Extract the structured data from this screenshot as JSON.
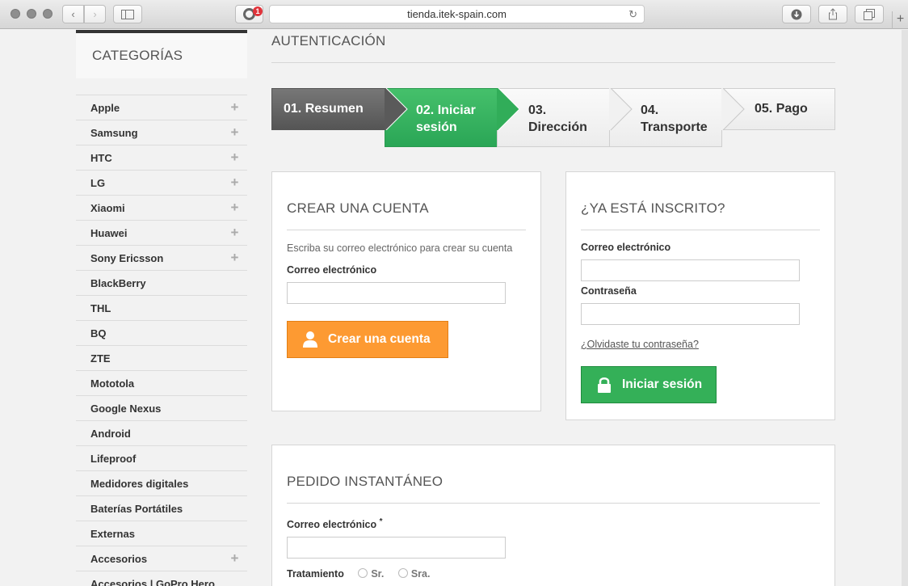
{
  "browser": {
    "url": "tienda.itek-spain.com",
    "extension_badge": "1"
  },
  "sidebar": {
    "title": "CATEGORÍAS",
    "items": [
      {
        "label": "Apple",
        "expandable": true
      },
      {
        "label": "Samsung",
        "expandable": true
      },
      {
        "label": "HTC",
        "expandable": true
      },
      {
        "label": "LG",
        "expandable": true
      },
      {
        "label": "Xiaomi",
        "expandable": true
      },
      {
        "label": "Huawei",
        "expandable": true
      },
      {
        "label": "Sony Ericsson",
        "expandable": true
      },
      {
        "label": "BlackBerry",
        "expandable": false
      },
      {
        "label": "THL",
        "expandable": false
      },
      {
        "label": "BQ",
        "expandable": false
      },
      {
        "label": "ZTE",
        "expandable": false
      },
      {
        "label": "Mototola",
        "expandable": false
      },
      {
        "label": "Google Nexus",
        "expandable": false
      },
      {
        "label": "Android",
        "expandable": false
      },
      {
        "label": "Lifeproof",
        "expandable": false
      },
      {
        "label": "Medidores digitales",
        "expandable": false
      },
      {
        "label": "Baterías Portátiles",
        "expandable": false
      },
      {
        "label": "Externas",
        "expandable": false
      },
      {
        "label": "Accesorios",
        "expandable": true
      },
      {
        "label": "Accesorios | GoPro Hero",
        "expandable": false
      }
    ]
  },
  "main": {
    "title": "AUTENTICACIÓN",
    "steps": [
      {
        "line1": "01. Resumen",
        "line2": "",
        "state": "done"
      },
      {
        "line1": "02. Iniciar",
        "line2": "sesión",
        "state": "current"
      },
      {
        "line1": "03.",
        "line2": "Dirección",
        "state": "todo"
      },
      {
        "line1": "04.",
        "line2": "Transporte",
        "state": "todo"
      },
      {
        "line1": "05. Pago",
        "line2": "",
        "state": "todo"
      }
    ],
    "create_account": {
      "title": "CREAR UNA CUENTA",
      "hint": "Escriba su correo electrónico para crear su cuenta",
      "email_label": "Correo electrónico",
      "email_value": "",
      "button": "Crear una cuenta"
    },
    "login": {
      "title": "¿YA ESTÁ INSCRITO?",
      "email_label": "Correo electrónico",
      "email_value": "",
      "password_label": "Contraseña",
      "password_value": "",
      "forgot": "¿Olvidaste tu contraseña?",
      "button": "Iniciar sesión"
    },
    "instant_order": {
      "title": "PEDIDO INSTANTÁNEO",
      "email_label": "Correo electrónico",
      "required_mark": "*",
      "email_value": "",
      "title_label": "Tratamiento",
      "options": [
        "Sr.",
        "Sra."
      ]
    }
  },
  "colors": {
    "step_done": "#5a5a5a",
    "step_current": "#34b058",
    "button_create": "#fd9a32",
    "button_login": "#34b058"
  }
}
